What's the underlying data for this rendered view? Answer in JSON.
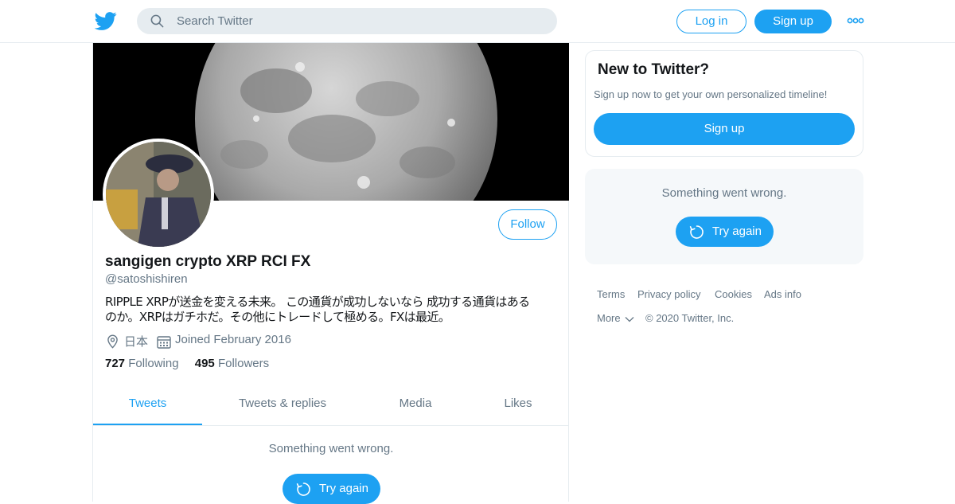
{
  "header": {
    "logo_icon": "twitter-bird-icon",
    "search_placeholder": "Search Twitter",
    "login_label": "Log in",
    "signup_label": "Sign up",
    "more_icon": "more-dots-icon"
  },
  "profile": {
    "display_name": "sangigen crypto XRP RCI FX",
    "handle": "@satoshishiren",
    "bio_line1": "RIPPLE XRPが送金を変える未来。 この通貨が成功しないなら 成功する通貨はある",
    "bio_line2": "のか。XRPはガチホだ。その他にトレードして極める。FXは最近。",
    "location": "日本",
    "joined": "Joined February 2016",
    "following_count": "727",
    "following_label": "Following",
    "followers_count": "495",
    "followers_label": "Followers",
    "follow_label": "Follow"
  },
  "tabs": [
    {
      "label": "Tweets",
      "active": true
    },
    {
      "label": "Tweets & replies",
      "active": false
    },
    {
      "label": "Media",
      "active": false
    },
    {
      "label": "Likes",
      "active": false
    }
  ],
  "timeline": {
    "error_text": "Something went wrong.",
    "retry_label": "Try again"
  },
  "sidebar": {
    "new_title": "New to Twitter?",
    "new_subtitle": "Sign up now to get your own personalized timeline!",
    "signup_label": "Sign up",
    "error_text": "Something went wrong.",
    "retry_label": "Try again",
    "footer_links": [
      "Terms",
      "Privacy policy",
      "Cookies",
      "Ads info"
    ],
    "more_label": "More",
    "copyright": "© 2020 Twitter, Inc."
  },
  "colors": {
    "brand": "#1da1f2",
    "text_secondary": "#657786",
    "border": "#e6ecf0"
  }
}
